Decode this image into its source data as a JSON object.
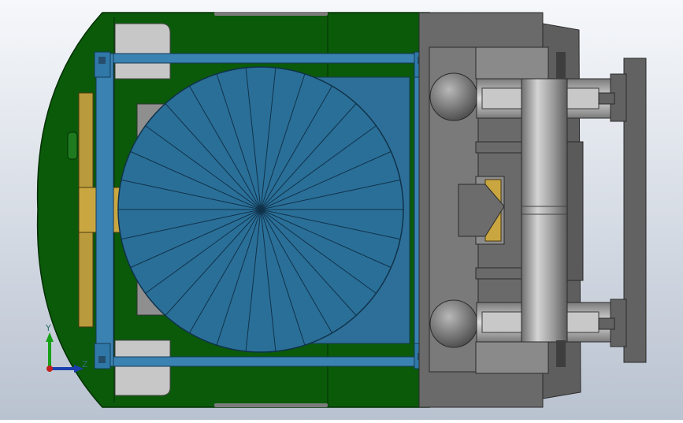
{
  "viewport": {
    "background_top": "#f6f8fb",
    "background_bottom": "#b9c2d0"
  },
  "model": {
    "body_color": "#0a5a0a",
    "body_dark": "#064006",
    "frame_color": "#2f78a8",
    "disc_color": "#2a6f98",
    "steel_light": "#9a9a9a",
    "steel_dark": "#5e5e5e",
    "accent_yellow": "#b99a3c",
    "window_color": "#c7c7c7"
  },
  "triad": {
    "y_label": "Y",
    "z_label": "Z",
    "y_color": "#17a017",
    "z_color": "#1c3fb0",
    "origin_color": "#c02020"
  }
}
